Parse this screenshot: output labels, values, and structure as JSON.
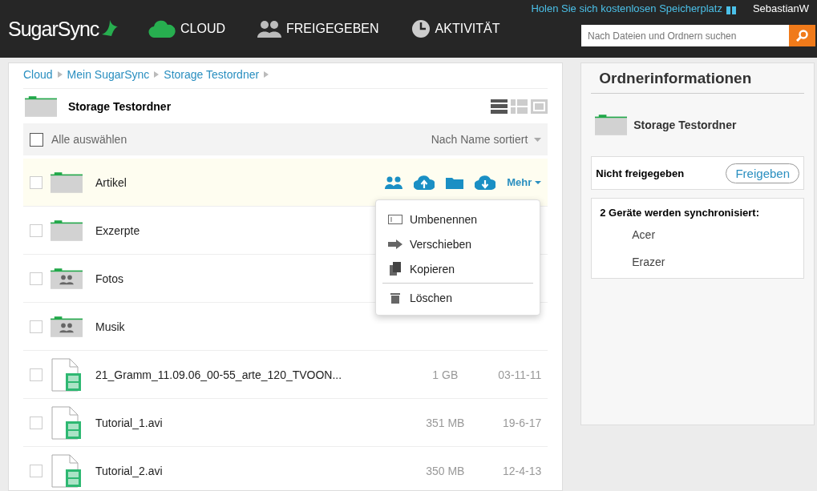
{
  "header": {
    "logo": "SugarSync",
    "nav": [
      {
        "label": "CLOUD",
        "kind": "cloud"
      },
      {
        "label": "FREIGEGEBEN",
        "kind": "shared"
      },
      {
        "label": "AKTIVITÄT",
        "kind": "activity"
      }
    ],
    "promo": "Holen Sie sich kostenlosen Speicherplatz",
    "user": "SebastianW",
    "search": {
      "placeholder": "Nach Dateien und Ordnern suchen"
    }
  },
  "breadcrumb": [
    "Cloud",
    "Mein SugarSync",
    "Storage Testordner"
  ],
  "folder": {
    "title": "Storage Testordner",
    "views": [
      {
        "kind": "list",
        "selected": true
      },
      {
        "kind": "grid",
        "selected": false
      },
      {
        "kind": "preview",
        "selected": false
      }
    ]
  },
  "list_header": {
    "select_all": "Alle auswählen",
    "checked": false,
    "sort": "Nach Name sortiert"
  },
  "rows": [
    {
      "kind": "folder",
      "name": "Artikel",
      "checked": false,
      "highlighted": true
    },
    {
      "kind": "folder",
      "name": "Exzerpte",
      "checked": false,
      "highlighted": false
    },
    {
      "kind": "shared-folder",
      "name": "Fotos",
      "checked": false,
      "highlighted": false
    },
    {
      "kind": "shared-folder",
      "name": "Musik",
      "checked": false,
      "highlighted": false
    },
    {
      "kind": "video",
      "name": "21_Gramm_11.09.06_00-55_arte_120_TVOON...",
      "size": "1 GB",
      "date": "03-11-11",
      "checked": false,
      "highlighted": false
    },
    {
      "kind": "video",
      "name": "Tutorial_1.avi",
      "size": "351 MB",
      "date": "19-6-17",
      "checked": false,
      "highlighted": false
    },
    {
      "kind": "video",
      "name": "Tutorial_2.avi",
      "size": "350 MB",
      "date": "12-4-13",
      "checked": false,
      "highlighted": false
    }
  ],
  "row_actions": {
    "more": "Mehr"
  },
  "menu": [
    {
      "kind": "rename",
      "label": "Umbenennen"
    },
    {
      "kind": "move",
      "label": "Verschieben"
    },
    {
      "kind": "copy",
      "label": "Kopieren"
    },
    {
      "kind": "separator"
    },
    {
      "kind": "delete",
      "label": "Löschen"
    }
  ],
  "info": {
    "title": "Ordnerinformationen",
    "folder": "Storage Testordner",
    "share_status": "Nicht freigegeben",
    "share_button": "Freigeben",
    "sync_title": "2 Geräte werden synchronisiert:",
    "devices": [
      "Acer",
      "Erazer"
    ]
  }
}
